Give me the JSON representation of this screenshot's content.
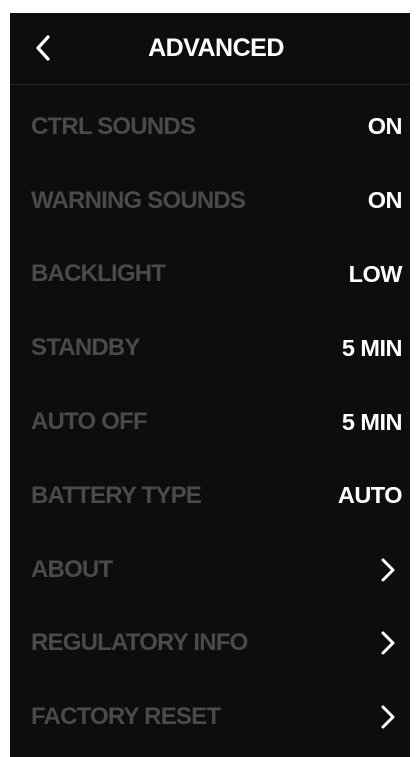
{
  "header": {
    "title": "ADVANCED",
    "back_icon": "chevron-left-icon"
  },
  "settings": [
    {
      "label": "CTRL SOUNDS",
      "value": "ON"
    },
    {
      "label": "WARNING SOUNDS",
      "value": "ON"
    },
    {
      "label": "BACKLIGHT",
      "value": "LOW"
    },
    {
      "label": "STANDBY",
      "value": "5 MIN"
    },
    {
      "label": "AUTO OFF",
      "value": "5 MIN"
    },
    {
      "label": "BATTERY TYPE",
      "value": "AUTO"
    },
    {
      "label": "ABOUT",
      "icon": "chevron-right-icon"
    },
    {
      "label": "REGULATORY INFO",
      "icon": "chevron-right-icon"
    },
    {
      "label": "FACTORY RESET",
      "icon": "chevron-right-icon"
    }
  ],
  "colors": {
    "background": "#0d0d0d",
    "label": "#4a4a4a",
    "value": "#ffffff"
  }
}
